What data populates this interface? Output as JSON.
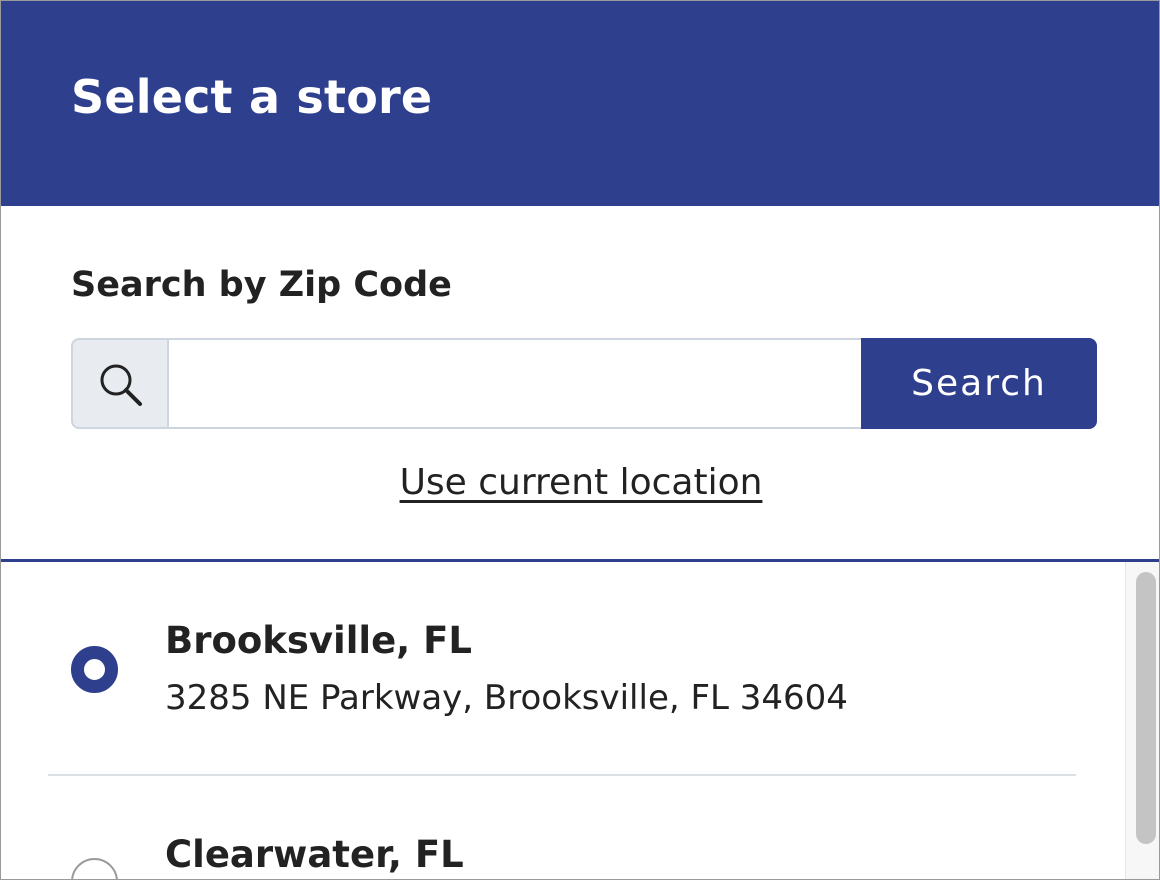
{
  "header": {
    "title": "Select a store"
  },
  "search": {
    "label": "Search by Zip Code",
    "input_value": "",
    "input_placeholder": "",
    "button_label": "Search",
    "icon": "search-icon"
  },
  "location_link": "Use current location",
  "stores": [
    {
      "name": "Brooksville, FL",
      "address": "3285 NE Parkway, Brooksville, FL 34604",
      "selected": true
    },
    {
      "name": "Clearwater, FL",
      "selected": false
    }
  ],
  "colors": {
    "brand": "#2e3f8e",
    "text": "#222222",
    "input_border": "#cfd5de",
    "icon_cell_bg": "#e8ebef"
  }
}
